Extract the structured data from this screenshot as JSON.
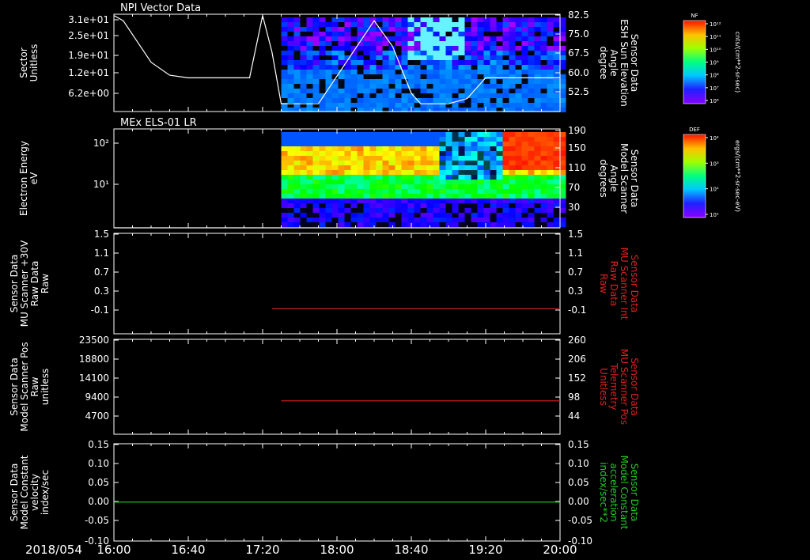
{
  "theme": {
    "background": "#000000",
    "foreground": "#ffffff",
    "red": "#e02020",
    "green": "#22cc22"
  },
  "footer": {
    "date": "2018/054"
  },
  "time_ticks": [
    "16:00",
    "16:40",
    "17:20",
    "18:00",
    "18:40",
    "19:20",
    "20:00"
  ],
  "colorbars": [
    {
      "tag": "NF",
      "ticks": [
        "10¹²",
        "10¹¹",
        "10¹⁰",
        "10⁹",
        "10⁸",
        "10⁷",
        "10⁶"
      ],
      "units": "cnts/(cm**2-sr-sec)"
    },
    {
      "tag": "DEF",
      "ticks": [
        "10⁴",
        "10³",
        "10²",
        "10¹"
      ],
      "units": "ergs/(cm**2-sr-sec-eV)"
    }
  ],
  "chart_data": [
    {
      "type": "heatmap",
      "title": "NPI Vector Data",
      "left_axis": {
        "label_lines": [
          "Sector",
          "Unitless"
        ],
        "ticks": [
          "3.1e+01",
          "2.5e+01",
          "1.9e+01",
          "1.2e+01",
          "6.2e+00"
        ]
      },
      "right_axis": {
        "label_lines": [
          "Sensor Data",
          "ESH Sun Elevation",
          "Angle",
          "degree"
        ],
        "ticks": [
          "82.5",
          "75.0",
          "67.5",
          "60.0",
          "52.5"
        ],
        "ylim": [
          45,
          82.5
        ]
      },
      "data_start": "17:30",
      "overlay_line": {
        "axis": "right",
        "x": [
          "16:00",
          "16:05",
          "16:20",
          "16:30",
          "16:40",
          "17:00",
          "17:13",
          "17:20",
          "17:25",
          "17:30",
          "17:50",
          "18:20",
          "18:30",
          "18:40",
          "18:45",
          "19:00",
          "19:10",
          "19:20",
          "20:00"
        ],
        "y": [
          82,
          80,
          64,
          59,
          58,
          58,
          58,
          82,
          68,
          48,
          48,
          80,
          70,
          52,
          48,
          48,
          50,
          58,
          58
        ]
      }
    },
    {
      "type": "heatmap",
      "title": "MEx ELS-01 LR",
      "left_axis": {
        "label_lines": [
          "Electron Energy",
          "eV"
        ],
        "ticks": [
          "10²",
          "10¹"
        ],
        "scale": "log"
      },
      "right_axis": {
        "label_lines": [
          "Sensor Data",
          "Model Scanner",
          "Angle",
          "degrees"
        ],
        "ticks": [
          "190",
          "150",
          "110",
          "70",
          "30"
        ],
        "ylim": [
          0,
          190
        ]
      },
      "data_start": "17:30",
      "overlay_line": {
        "axis": "right",
        "x": [
          "16:00",
          "20:00"
        ],
        "y": [
          0,
          0
        ]
      }
    },
    {
      "type": "line",
      "left_axis": {
        "label_lines": [
          "Sensor Data",
          "MU Scanner +30V",
          "Raw Data",
          "Raw"
        ],
        "ticks": [
          "1.5",
          "1.1",
          "0.7",
          "0.3",
          "-0.1"
        ],
        "ylim": [
          -0.5,
          1.5
        ]
      },
      "right_axis": {
        "label_lines": [
          "Sensor Data",
          "MU Scanner Int",
          "Raw Data",
          "Raw"
        ],
        "ticks": [
          "1.5",
          "1.1",
          "0.7",
          "0.3",
          "-0.1"
        ],
        "ylim": [
          -0.5,
          1.5
        ]
      },
      "series": [
        {
          "axis": "right",
          "x": [
            "17:25",
            "20:00"
          ],
          "y": [
            0,
            0
          ]
        }
      ]
    },
    {
      "type": "line",
      "left_axis": {
        "label_lines": [
          "Sensor Data",
          "Model Scanner Pos",
          "Raw",
          "unitless"
        ],
        "ticks": [
          "23500",
          "18800",
          "14100",
          "9400",
          "4700"
        ],
        "ylim": [
          0,
          23500
        ]
      },
      "right_axis": {
        "label_lines": [
          "Sensor Data",
          "MU Scanner Pos",
          "Telemetry",
          "Unitless"
        ],
        "ticks": [
          "260",
          "206",
          "152",
          "98",
          "44"
        ],
        "ylim": [
          -10,
          260
        ]
      },
      "series": [
        {
          "axis": "right",
          "x": [
            "17:30",
            "20:00"
          ],
          "y": [
            85,
            85
          ]
        }
      ]
    },
    {
      "type": "line",
      "left_axis": {
        "label_lines": [
          "Sensor Data",
          "Model Constant",
          "velocity",
          "index/sec"
        ],
        "ticks": [
          "0.15",
          "0.10",
          "0.05",
          "0.00",
          "-0.05",
          "-0.10"
        ],
        "ylim": [
          -0.1,
          0.15
        ]
      },
      "right_axis": {
        "label_lines": [
          "Sensor Data",
          "Model Constant",
          "acceleration",
          "index/sec**2"
        ],
        "ticks": [
          "0.15",
          "0.10",
          "0.05",
          "0.00",
          "-0.05",
          "-0.10"
        ],
        "ylim": [
          -0.1,
          0.15
        ]
      },
      "series": [
        {
          "axis": "right",
          "x": [
            "16:00",
            "20:00"
          ],
          "y": [
            0,
            0
          ]
        }
      ]
    }
  ]
}
